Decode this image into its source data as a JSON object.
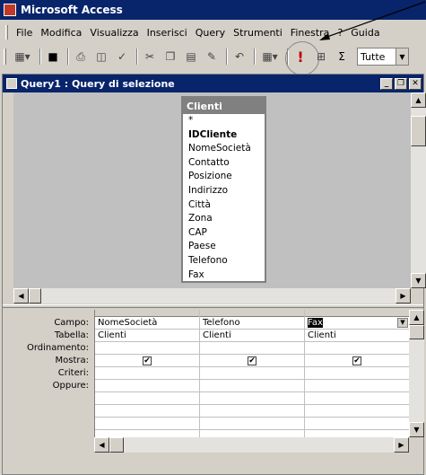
{
  "app": {
    "title": "Microsoft Access"
  },
  "menu": [
    "File",
    "Modifica",
    "Visualizza",
    "Inserisci",
    "Query",
    "Strumenti",
    "Finestra",
    "?",
    "Guida"
  ],
  "toolbar": {
    "combo_value": "Tutte"
  },
  "window": {
    "title": "Query1 : Query di selezione"
  },
  "table": {
    "name": "Clienti",
    "fields": [
      "*",
      "IDCliente",
      "NomeSocietà",
      "Contatto",
      "Posizione",
      "Indirizzo",
      "Città",
      "Zona",
      "CAP",
      "Paese",
      "Telefono",
      "Fax"
    ]
  },
  "grid": {
    "row_labels": [
      "Campo:",
      "Tabella:",
      "Ordinamento:",
      "Mostra:",
      "Criteri:",
      "Oppure:"
    ],
    "columns": [
      {
        "campo": "NomeSocietà",
        "tabella": "Clienti",
        "mostra": "✔"
      },
      {
        "campo": "Telefono",
        "tabella": "Clienti",
        "mostra": "✔"
      },
      {
        "campo": "Fax",
        "tabella": "Clienti",
        "mostra": "✔"
      }
    ]
  },
  "colors": {
    "titlebar": "#08246b",
    "run_icon": "#c00000"
  }
}
